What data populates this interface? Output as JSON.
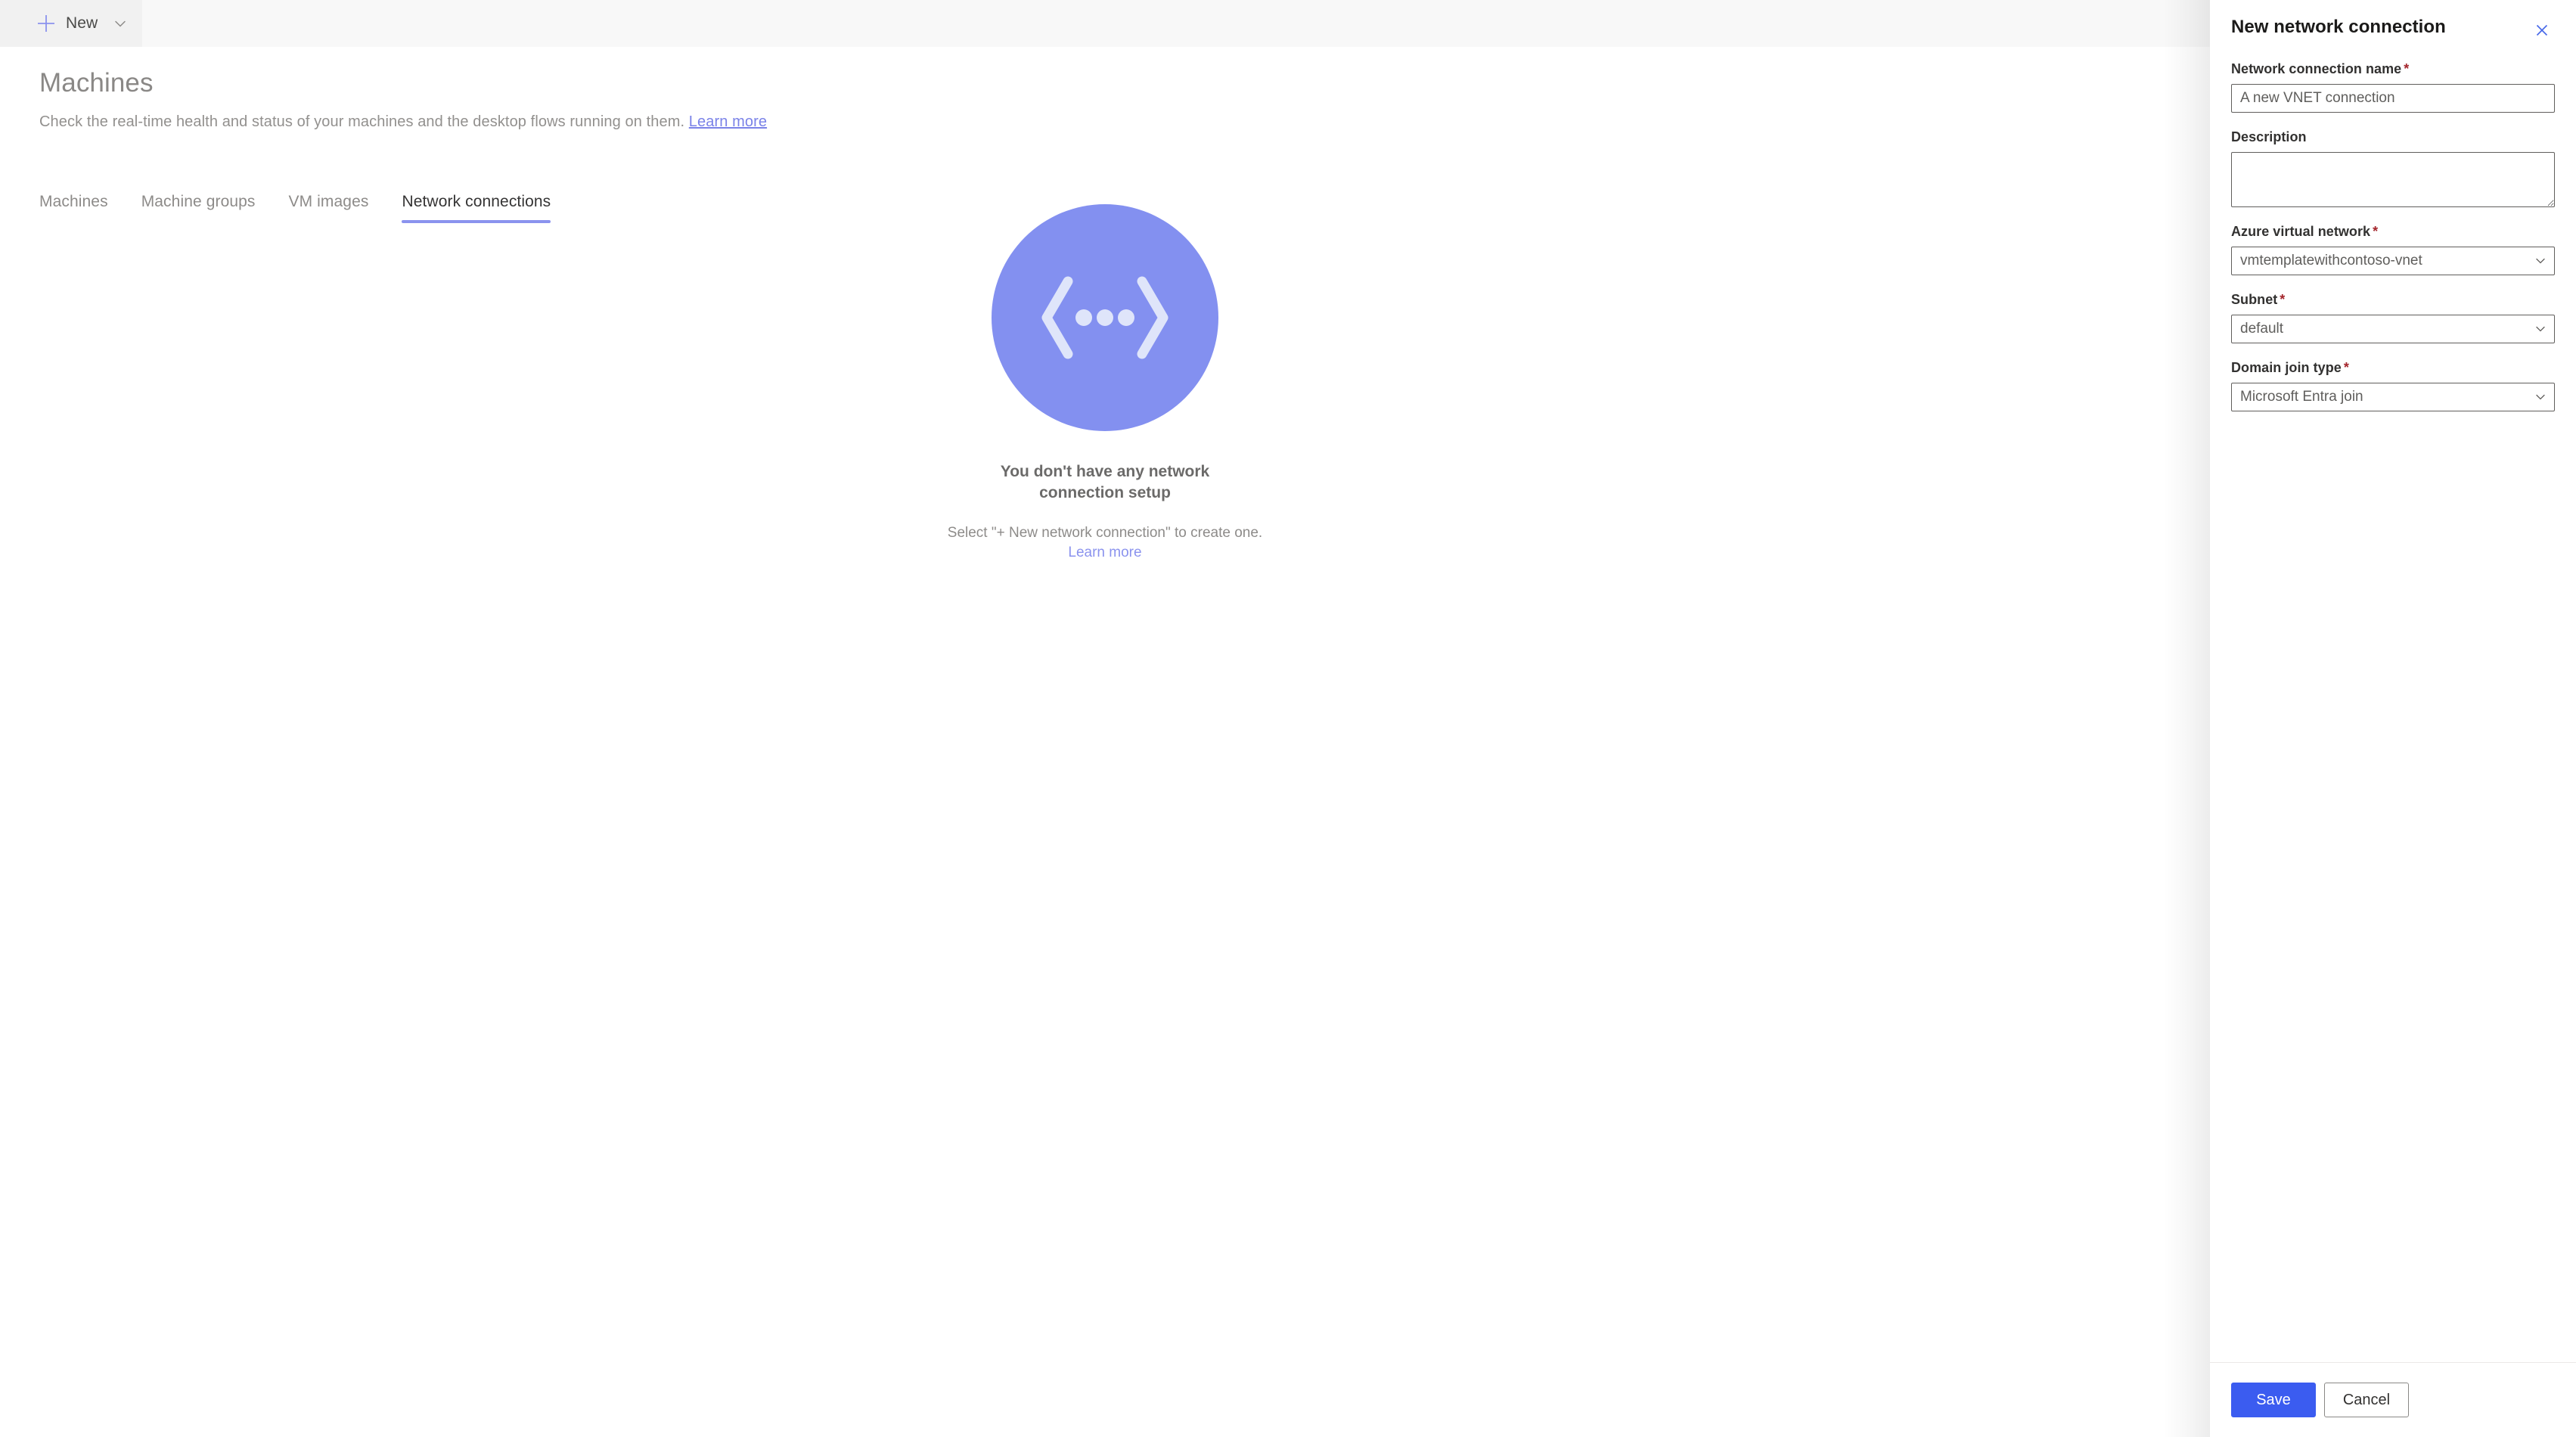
{
  "command_bar": {
    "new_button": {
      "label": "New",
      "icon": "plus-icon",
      "chevron": "chevron-down-icon"
    }
  },
  "page": {
    "title": "Machines",
    "subtitle": "Check the real-time health and status of your machines and the desktop flows running on them.",
    "subtitle_link": "Learn more"
  },
  "tabs": [
    {
      "label": "Machines",
      "active": false
    },
    {
      "label": "Machine groups",
      "active": false
    },
    {
      "label": "VM images",
      "active": false
    },
    {
      "label": "Network connections",
      "active": true
    }
  ],
  "empty_state": {
    "illustration_icon": "network-connection-illustration",
    "title": "You don't have any network connection setup",
    "description": "Select \"+ New network connection\" to create one.",
    "link": "Learn more",
    "circle_color": "#8390f0",
    "glyph_color": "#dfe5fa"
  },
  "panel": {
    "title": "New network connection",
    "close_icon": "close-icon",
    "close_color": "#4668e8",
    "fields": {
      "name": {
        "label": "Network connection name",
        "required": true,
        "value": "A new VNET connection",
        "placeholder": "A new VNET connection"
      },
      "description": {
        "label": "Description",
        "required": false,
        "value": "",
        "placeholder": ""
      },
      "vnet": {
        "label": "Azure virtual network",
        "required": true,
        "value": "vmtemplatewithcontoso-vnet",
        "options": [
          "vmtemplatewithcontoso-vnet"
        ]
      },
      "subnet": {
        "label": "Subnet",
        "required": true,
        "value": "default",
        "options": [
          "default"
        ]
      },
      "domain_join_type": {
        "label": "Domain join type",
        "required": true,
        "value": "Microsoft Entra join",
        "options": [
          "Microsoft Entra join"
        ]
      }
    },
    "required_marker": "*",
    "footer": {
      "save_label": "Save",
      "cancel_label": "Cancel",
      "primary_color": "#3b5cf0"
    }
  }
}
